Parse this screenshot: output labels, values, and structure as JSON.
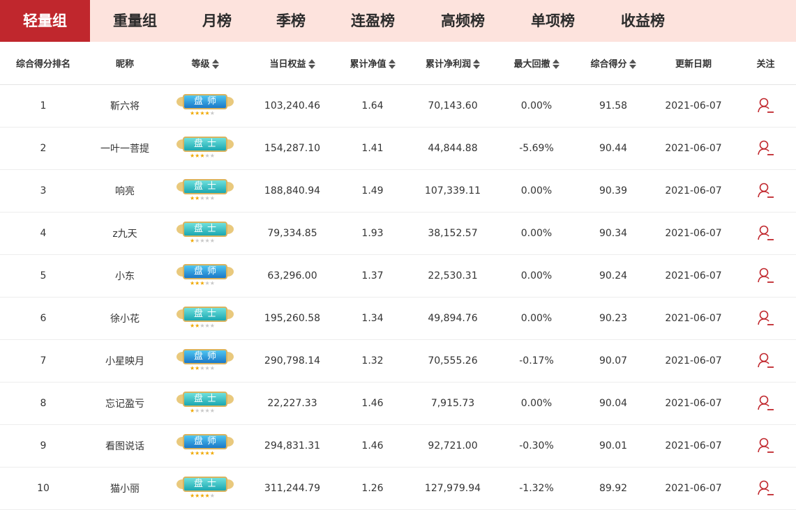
{
  "tabs": [
    {
      "label": "轻量组",
      "active": true
    },
    {
      "label": "重量组",
      "active": false
    },
    {
      "label": "月榜",
      "active": false
    },
    {
      "label": "季榜",
      "active": false
    },
    {
      "label": "连盈榜",
      "active": false
    },
    {
      "label": "高频榜",
      "active": false
    },
    {
      "label": "单项榜",
      "active": false
    },
    {
      "label": "收益榜",
      "active": false
    }
  ],
  "table": {
    "headers": [
      "综合得分排名",
      "昵称",
      "等级",
      "当日权益",
      "累计净值",
      "累计净利润",
      "最大回撤",
      "综合得分",
      "更新日期",
      "关注"
    ],
    "sortable": [
      false,
      false,
      true,
      true,
      true,
      true,
      true,
      true,
      false,
      false
    ],
    "rows": [
      {
        "rank": "1",
        "name": "靳六将",
        "level": "盘师",
        "level_type": "shi",
        "stars": 4,
        "equity": "103,240.46",
        "nav": "1.64",
        "profit": "70,143.60",
        "drawdown": "0.00%",
        "score": "91.58",
        "date": "2021-06-07"
      },
      {
        "rank": "2",
        "name": "一叶一菩提",
        "level": "盘士",
        "level_type": "tu",
        "stars": 3,
        "equity": "154,287.10",
        "nav": "1.41",
        "profit": "44,844.88",
        "drawdown": "-5.69%",
        "score": "90.44",
        "date": "2021-06-07"
      },
      {
        "rank": "3",
        "name": "响亮",
        "level": "盘士",
        "level_type": "tu",
        "stars": 2,
        "equity": "188,840.94",
        "nav": "1.49",
        "profit": "107,339.11",
        "drawdown": "0.00%",
        "score": "90.39",
        "date": "2021-06-07"
      },
      {
        "rank": "4",
        "name": "z九天",
        "level": "盘士",
        "level_type": "tu",
        "stars": 1,
        "equity": "79,334.85",
        "nav": "1.93",
        "profit": "38,152.57",
        "drawdown": "0.00%",
        "score": "90.34",
        "date": "2021-06-07"
      },
      {
        "rank": "5",
        "name": "小东",
        "level": "盘师",
        "level_type": "shi",
        "stars": 3,
        "equity": "63,296.00",
        "nav": "1.37",
        "profit": "22,530.31",
        "drawdown": "0.00%",
        "score": "90.24",
        "date": "2021-06-07"
      },
      {
        "rank": "6",
        "name": "徐小花",
        "level": "盘士",
        "level_type": "tu",
        "stars": 2,
        "equity": "195,260.58",
        "nav": "1.34",
        "profit": "49,894.76",
        "drawdown": "0.00%",
        "score": "90.23",
        "date": "2021-06-07"
      },
      {
        "rank": "7",
        "name": "小星映月",
        "level": "盘师",
        "level_type": "shi",
        "stars": 2,
        "equity": "290,798.14",
        "nav": "1.32",
        "profit": "70,555.26",
        "drawdown": "-0.17%",
        "score": "90.07",
        "date": "2021-06-07"
      },
      {
        "rank": "8",
        "name": "忘记盈亏",
        "level": "盘士",
        "level_type": "tu",
        "stars": 1,
        "equity": "22,227.33",
        "nav": "1.46",
        "profit": "7,915.73",
        "drawdown": "0.00%",
        "score": "90.04",
        "date": "2021-06-07"
      },
      {
        "rank": "9",
        "name": "看图说话",
        "level": "盘师",
        "level_type": "shi",
        "stars": 5,
        "equity": "294,831.31",
        "nav": "1.46",
        "profit": "92,721.00",
        "drawdown": "-0.30%",
        "score": "90.01",
        "date": "2021-06-07"
      },
      {
        "rank": "10",
        "name": "猫小丽",
        "level": "盘士",
        "level_type": "tu",
        "stars": 4,
        "equity": "311,244.79",
        "nav": "1.26",
        "profit": "127,979.94",
        "drawdown": "-1.32%",
        "score": "89.92",
        "date": "2021-06-07"
      }
    ]
  },
  "colors": {
    "accent": "#c0272d",
    "tab_bg": "#fde3dd",
    "follow_icon": "#c0272d"
  },
  "icons": {
    "follow": "user-follow-icon",
    "sort": "sort-icon",
    "level_badge": "level-badge-icon"
  }
}
